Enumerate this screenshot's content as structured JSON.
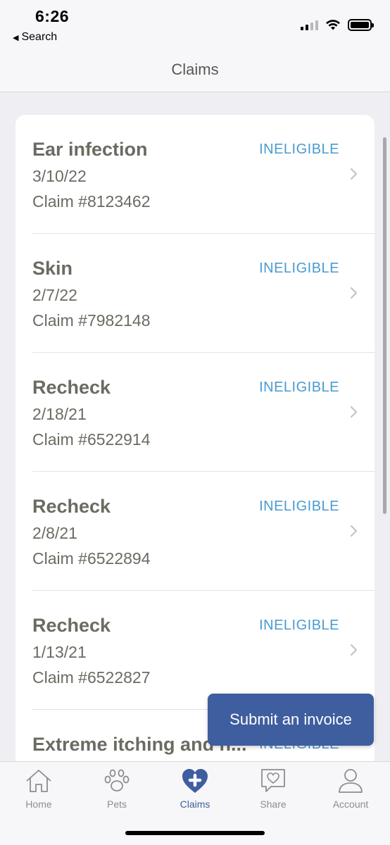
{
  "status_bar": {
    "time": "6:26",
    "back_label": "Search"
  },
  "header": {
    "title": "Claims"
  },
  "claims": [
    {
      "name": "Ear infection",
      "date": "3/10/22",
      "claim_number": "Claim #8123462",
      "status": "INELIGIBLE"
    },
    {
      "name": "Skin",
      "date": "2/7/22",
      "claim_number": "Claim #7982148",
      "status": "INELIGIBLE"
    },
    {
      "name": "Recheck",
      "date": "2/18/21",
      "claim_number": "Claim #6522914",
      "status": "INELIGIBLE"
    },
    {
      "name": "Recheck",
      "date": "2/8/21",
      "claim_number": "Claim #6522894",
      "status": "INELIGIBLE"
    },
    {
      "name": "Recheck",
      "date": "1/13/21",
      "claim_number": "Claim #6522827",
      "status": "INELIGIBLE"
    },
    {
      "name": "Extreme itching and h...",
      "date": "",
      "claim_number": "",
      "status": "INELIGIBLE"
    }
  ],
  "submit_button": {
    "label": "Submit an invoice"
  },
  "tabs": [
    {
      "label": "Home",
      "icon": "home-icon"
    },
    {
      "label": "Pets",
      "icon": "paw-icon"
    },
    {
      "label": "Claims",
      "icon": "claims-heart-icon",
      "active": true
    },
    {
      "label": "Share",
      "icon": "share-heart-icon"
    },
    {
      "label": "Account",
      "icon": "account-icon"
    }
  ],
  "colors": {
    "accent": "#3f5e9f",
    "status_blue": "#4a9bd0",
    "text": "#6b6b62",
    "background": "#efeef3"
  }
}
